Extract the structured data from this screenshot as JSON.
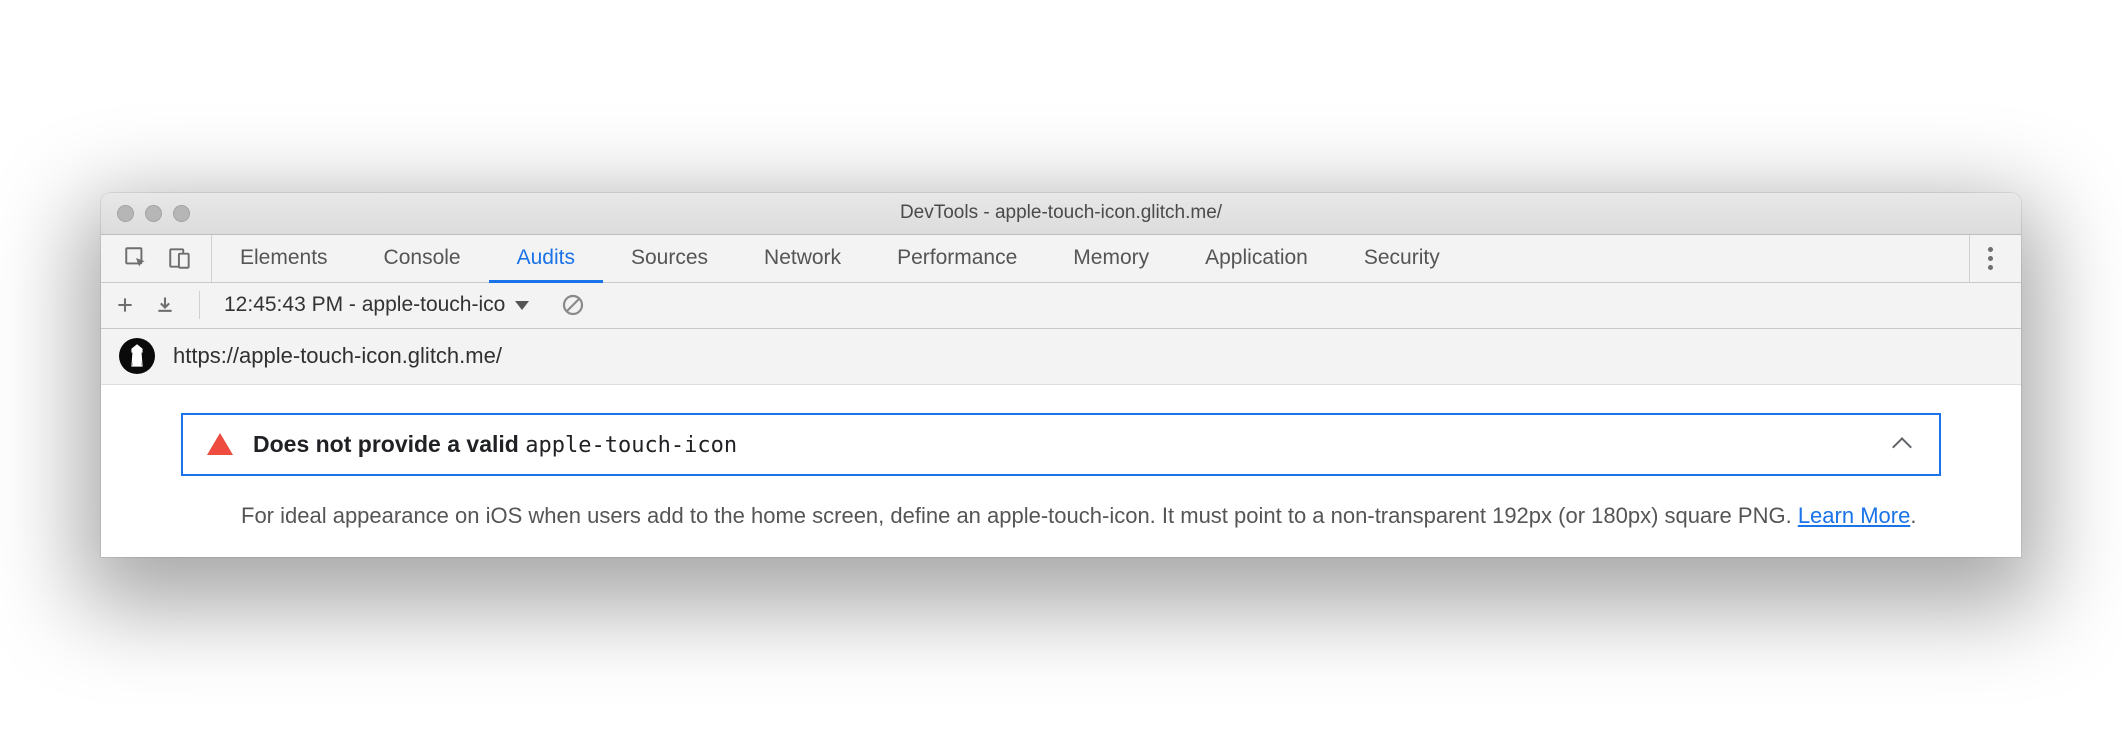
{
  "window": {
    "title": "DevTools - apple-touch-icon.glitch.me/"
  },
  "tabs": [
    {
      "label": "Elements",
      "active": false
    },
    {
      "label": "Console",
      "active": false
    },
    {
      "label": "Audits",
      "active": true
    },
    {
      "label": "Sources",
      "active": false
    },
    {
      "label": "Network",
      "active": false
    },
    {
      "label": "Performance",
      "active": false
    },
    {
      "label": "Memory",
      "active": false
    },
    {
      "label": "Application",
      "active": false
    },
    {
      "label": "Security",
      "active": false
    }
  ],
  "toolbar": {
    "report_label": "12:45:43 PM - apple-touch-ico"
  },
  "report": {
    "url": "https://apple-touch-icon.glitch.me/"
  },
  "audit": {
    "title_prefix": "Does not provide a valid ",
    "title_code": "apple-touch-icon",
    "description": "For ideal appearance on iOS when users add to the home screen, define an apple-touch-icon. It must point to a non-transparent 192px (or 180px) square PNG. ",
    "learn_more_label": "Learn More",
    "period": "."
  }
}
